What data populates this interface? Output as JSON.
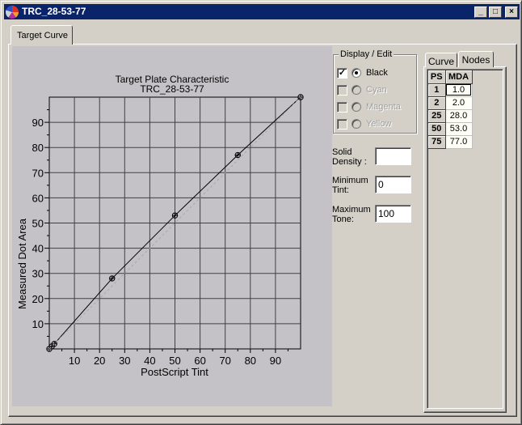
{
  "window": {
    "title": "TRC_28-53-77",
    "buttons": {
      "minimize": "_",
      "maximize": "□",
      "close": "×"
    }
  },
  "tabs": {
    "main": "Target Curve"
  },
  "chart_data": {
    "type": "line",
    "title": "Target Plate Characteristic",
    "subtitle": "TRC_28-53-77",
    "xlabel": "PostScript Tint",
    "ylabel": "Measured Dot Area",
    "xlim": [
      0,
      100
    ],
    "ylim": [
      0,
      100
    ],
    "xticks": [
      10,
      20,
      30,
      40,
      50,
      60,
      70,
      80,
      90
    ],
    "yticks": [
      10,
      20,
      30,
      40,
      50,
      60,
      70,
      80,
      90
    ],
    "grid": true,
    "series": [
      {
        "name": "Target curve",
        "style": "solid",
        "x": [
          0,
          1,
          2,
          25,
          50,
          75,
          100
        ],
        "y": [
          0,
          1,
          2,
          28,
          53,
          77,
          100
        ],
        "markers": true
      },
      {
        "name": "Linear reference",
        "style": "dashed",
        "x": [
          0,
          100
        ],
        "y": [
          0,
          100
        ],
        "markers": false
      }
    ]
  },
  "display_edit": {
    "legend": "Display / Edit",
    "channels": [
      {
        "label": "Black",
        "checked": true,
        "selected": true,
        "enabled": true
      },
      {
        "label": "Cyan",
        "checked": false,
        "selected": false,
        "enabled": false
      },
      {
        "label": "Magenta",
        "checked": false,
        "selected": false,
        "enabled": false
      },
      {
        "label": "Yellow",
        "checked": false,
        "selected": false,
        "enabled": false
      }
    ]
  },
  "fields": {
    "solid_density": {
      "label1": "Solid",
      "label2": "Density :",
      "value": ""
    },
    "minimum_tint": {
      "label1": "Minimum",
      "label2": "Tint:",
      "value": "0"
    },
    "maximum_tone": {
      "label1": "Maximum",
      "label2": "Tone:",
      "value": "100"
    }
  },
  "side_tabs": {
    "curve": "Curve",
    "nodes": "Nodes"
  },
  "nodes_table": {
    "headers": [
      "PS",
      "MDA"
    ],
    "rows": [
      {
        "ps": "1",
        "mda": "1.0"
      },
      {
        "ps": "2",
        "mda": "2.0"
      },
      {
        "ps": "25",
        "mda": "28.0"
      },
      {
        "ps": "50",
        "mda": "53.0"
      },
      {
        "ps": "75",
        "mda": "77.0"
      }
    ]
  }
}
